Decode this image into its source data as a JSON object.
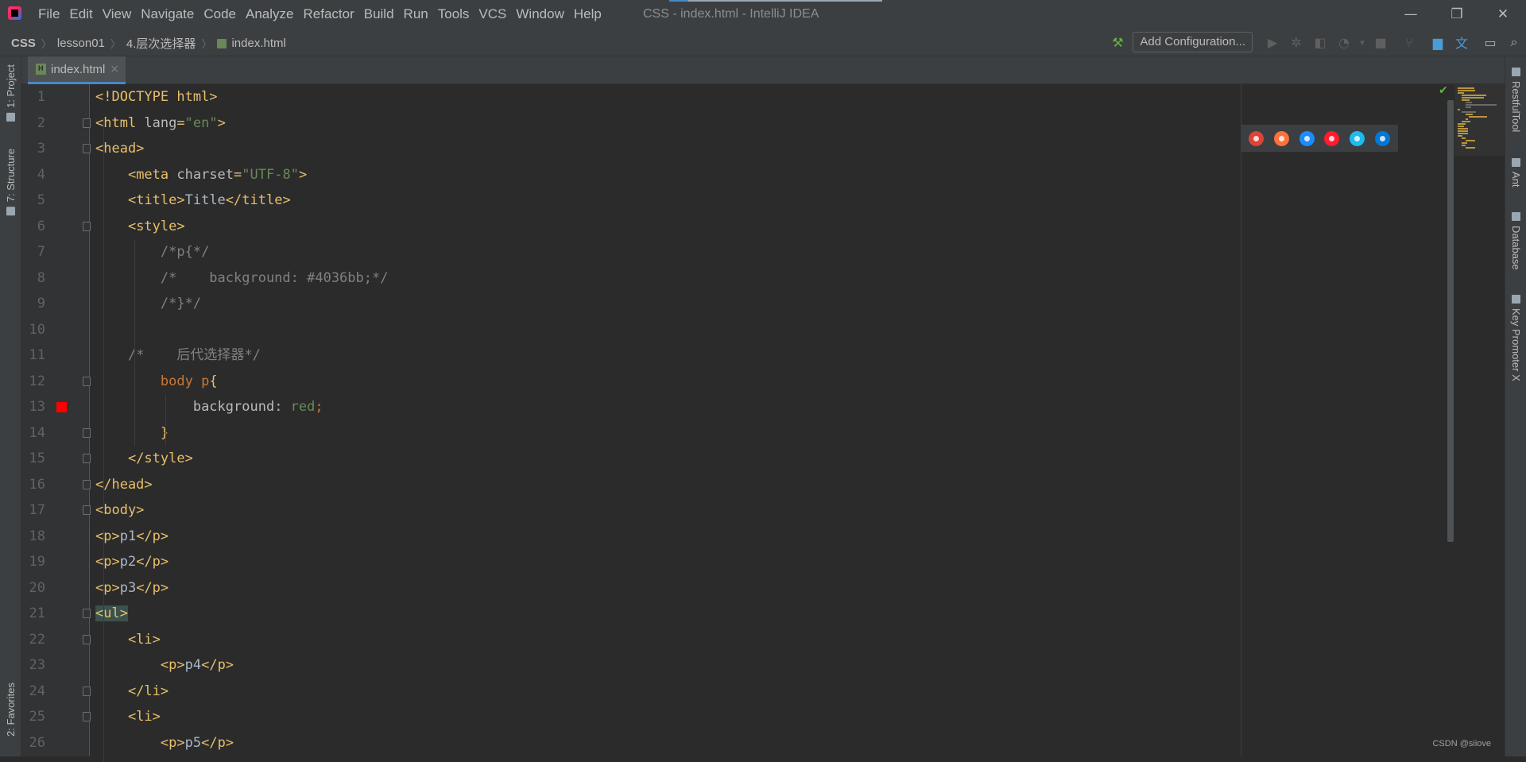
{
  "window": {
    "title": "CSS - index.html - IntelliJ IDEA",
    "controls": [
      "—",
      "❐",
      "✕"
    ]
  },
  "menu": [
    "File",
    "Edit",
    "View",
    "Navigate",
    "Code",
    "Analyze",
    "Refactor",
    "Build",
    "Run",
    "Tools",
    "VCS",
    "Window",
    "Help"
  ],
  "breadcrumb": [
    "CSS",
    "lesson01",
    "4.层次选择器",
    "index.html"
  ],
  "toolbar": {
    "add_configuration": "Add Configuration..."
  },
  "left_tools": [
    "1: Project",
    "7: Structure",
    "2: Favorites"
  ],
  "right_tools": [
    "RestfulTool",
    "Ant",
    "Database",
    "Key Promoter X"
  ],
  "tabs": [
    {
      "label": "index.html",
      "close": "×"
    }
  ],
  "browsers": [
    "chrome",
    "firefox",
    "safari",
    "opera",
    "internet-explorer",
    "edge"
  ],
  "colors": {
    "chrome": "#db4437",
    "firefox": "#ff7139",
    "safari": "#1a8cff",
    "opera": "#ff1b2d",
    "internet-explorer": "#1ebbee",
    "edge": "#0078d7"
  },
  "code_lines": [
    {
      "num": "1",
      "parts": [
        [
          "tag",
          "<!DOCTYPE html>"
        ]
      ]
    },
    {
      "num": "2",
      "parts": [
        [
          "tag",
          "<html "
        ],
        [
          "attr",
          "lang"
        ],
        [
          "tag",
          "="
        ],
        [
          "str",
          "\"en\""
        ],
        [
          "tag",
          ">"
        ]
      ]
    },
    {
      "num": "3",
      "parts": [
        [
          "tag",
          "<head>"
        ]
      ]
    },
    {
      "num": "4",
      "parts": [
        [
          "",
          "    "
        ],
        [
          "tag",
          "<meta "
        ],
        [
          "attr",
          "charset"
        ],
        [
          "tag",
          "="
        ],
        [
          "str",
          "\"UTF-8\""
        ],
        [
          "tag",
          ">"
        ]
      ]
    },
    {
      "num": "5",
      "parts": [
        [
          "",
          "    "
        ],
        [
          "tag",
          "<title>"
        ],
        [
          "",
          "Title"
        ],
        [
          "tag",
          "</title>"
        ]
      ]
    },
    {
      "num": "6",
      "parts": [
        [
          "",
          "    "
        ],
        [
          "tag",
          "<style>"
        ]
      ]
    },
    {
      "num": "7",
      "parts": [
        [
          "",
          "        "
        ],
        [
          "cm",
          "/*p{*/"
        ]
      ]
    },
    {
      "num": "8",
      "parts": [
        [
          "",
          "        "
        ],
        [
          "cm",
          "/*    background: #4036bb;*/"
        ]
      ]
    },
    {
      "num": "9",
      "parts": [
        [
          "",
          "        "
        ],
        [
          "cm",
          "/*}*/"
        ]
      ]
    },
    {
      "num": "10",
      "parts": [
        [
          "",
          ""
        ]
      ]
    },
    {
      "num": "11",
      "parts": [
        [
          "",
          "    "
        ],
        [
          "cm",
          "/*    后代选择器*/"
        ]
      ]
    },
    {
      "num": "12",
      "parts": [
        [
          "",
          "        "
        ],
        [
          "sel",
          "body p"
        ],
        [
          "tag",
          "{"
        ]
      ]
    },
    {
      "num": "13",
      "parts": [
        [
          "",
          "            "
        ],
        [
          "attr",
          "background"
        ],
        [
          "",
          ": "
        ],
        [
          "str",
          "red"
        ],
        [
          "sel",
          ";"
        ]
      ]
    },
    {
      "num": "14",
      "parts": [
        [
          "",
          "        "
        ],
        [
          "tag",
          "}"
        ]
      ]
    },
    {
      "num": "15",
      "parts": [
        [
          "",
          "    "
        ],
        [
          "tag",
          "</style>"
        ]
      ]
    },
    {
      "num": "16",
      "parts": [
        [
          "tag",
          "</head>"
        ]
      ]
    },
    {
      "num": "17",
      "parts": [
        [
          "tag",
          "<body>"
        ]
      ]
    },
    {
      "num": "18",
      "parts": [
        [
          "tag",
          "<p>"
        ],
        [
          "",
          "p1"
        ],
        [
          "tag",
          "</p>"
        ]
      ]
    },
    {
      "num": "19",
      "parts": [
        [
          "tag",
          "<p>"
        ],
        [
          "",
          "p2"
        ],
        [
          "tag",
          "</p>"
        ]
      ]
    },
    {
      "num": "20",
      "parts": [
        [
          "tag",
          "<p>"
        ],
        [
          "",
          "p3"
        ],
        [
          "tag",
          "</p>"
        ]
      ]
    },
    {
      "num": "21",
      "parts": [
        [
          "hl",
          "<ul>"
        ]
      ]
    },
    {
      "num": "22",
      "parts": [
        [
          "",
          "    "
        ],
        [
          "tag",
          "<li>"
        ]
      ]
    },
    {
      "num": "23",
      "parts": [
        [
          "",
          "        "
        ],
        [
          "tag",
          "<p>"
        ],
        [
          "",
          "p4"
        ],
        [
          "tag",
          "</p>"
        ]
      ]
    },
    {
      "num": "24",
      "parts": [
        [
          "",
          "    "
        ],
        [
          "tag",
          "</li>"
        ]
      ]
    },
    {
      "num": "25",
      "parts": [
        [
          "",
          "    "
        ],
        [
          "tag",
          "<li>"
        ]
      ]
    },
    {
      "num": "26",
      "parts": [
        [
          "",
          "        "
        ],
        [
          "tag",
          "<p>"
        ],
        [
          "",
          "p5"
        ],
        [
          "tag",
          "</p>"
        ]
      ]
    }
  ],
  "folded_lines": [
    "2",
    "3",
    "6",
    "12",
    "14",
    "15",
    "16",
    "17",
    "21",
    "22",
    "24",
    "25"
  ],
  "breakpoint_lines": [
    "13"
  ],
  "watermark": "CSDN @siiove"
}
